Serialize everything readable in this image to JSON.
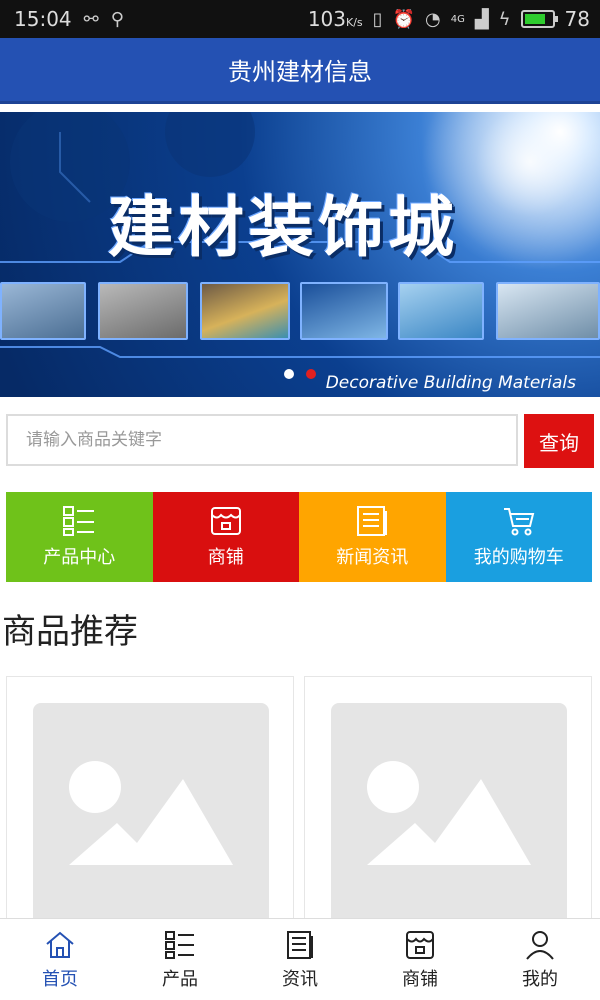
{
  "status_bar": {
    "time": "15:04",
    "speed": "103",
    "speed_unit": "K/s",
    "network": "4G",
    "battery": "78",
    "battery_level": 0.78,
    "battery_color": "#2ecc2e"
  },
  "app_bar": {
    "title": "贵州建材信息"
  },
  "banner": {
    "title": "建材装饰城",
    "caption": "Decorative Building Materials",
    "active_slide": 2,
    "slide_count": 2
  },
  "search": {
    "placeholder": "请输入商品关键字",
    "button_label": "查询"
  },
  "quick_nav": [
    {
      "label": "产品中心",
      "icon": "grid-list-icon",
      "color": "#6fc21a"
    },
    {
      "label": "商铺",
      "icon": "shop-icon",
      "color": "#d90f0f"
    },
    {
      "label": "新闻资讯",
      "icon": "newspaper-icon",
      "color": "#ffa500"
    },
    {
      "label": "我的购物车",
      "icon": "cart-icon",
      "color": "#1a9fe0"
    }
  ],
  "section": {
    "title": "商品推荐"
  },
  "bottom_nav": [
    {
      "label": "首页",
      "icon": "home-icon",
      "active": true
    },
    {
      "label": "产品",
      "icon": "grid-list-icon",
      "active": false
    },
    {
      "label": "资讯",
      "icon": "newspaper-icon",
      "active": false
    },
    {
      "label": "商铺",
      "icon": "shop-icon",
      "active": false
    },
    {
      "label": "我的",
      "icon": "person-icon",
      "active": false
    }
  ],
  "colors": {
    "primary": "#2451b3",
    "search_button": "#dd1111",
    "active_dot": "#e02020"
  }
}
